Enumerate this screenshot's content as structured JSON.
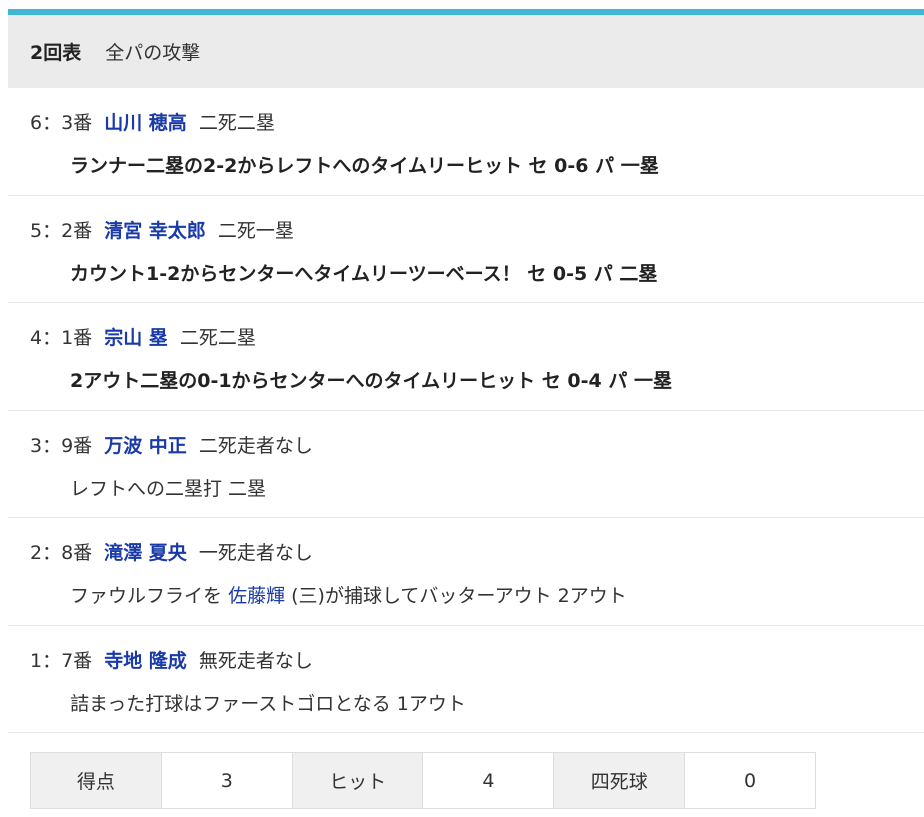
{
  "header": {
    "inning": "2回表",
    "team": "全パの攻撃"
  },
  "plays": [
    {
      "seq": "6：3番",
      "batter": "山川 穂高",
      "situation": "二死二塁",
      "result": "ランナー二塁の2-2からレフトへのタイムリーヒット セ 0-6 パ 一塁",
      "bold": true
    },
    {
      "seq": "5：2番",
      "batter": "清宮 幸太郎",
      "situation": "二死一塁",
      "result": "カウント1-2からセンターへタイムリーツーベース！ セ 0-5 パ 二塁",
      "bold": true
    },
    {
      "seq": "4：1番",
      "batter": "宗山 塁",
      "situation": "二死二塁",
      "result": "2アウト二塁の0-1からセンターへのタイムリーヒット セ 0-4 パ 一塁",
      "bold": true
    },
    {
      "seq": "3：9番",
      "batter": "万波 中正",
      "situation": "二死走者なし",
      "result": "レフトへの二塁打 二塁",
      "bold": false
    },
    {
      "seq": "2：8番",
      "batter": "滝澤 夏央",
      "situation": "一死走者なし",
      "result_prefix": "ファウルフライを",
      "fielder": "佐藤輝",
      "result_suffix": "(三)が捕球してバッターアウト 2アウト",
      "bold": false
    },
    {
      "seq": "1：7番",
      "batter": "寺地 隆成",
      "situation": "無死走者なし",
      "result": "詰まった打球はファーストゴロとなる 1アウト",
      "bold": false
    }
  ],
  "summary": {
    "runs_label": "得点",
    "runs": "3",
    "hits_label": "ヒット",
    "hits": "4",
    "walks_label": "四死球",
    "walks": "0"
  },
  "colors": {
    "accent_bar": "#40b7d6",
    "player_link": "#1a3aa8",
    "header_bg": "#ebebeb"
  }
}
